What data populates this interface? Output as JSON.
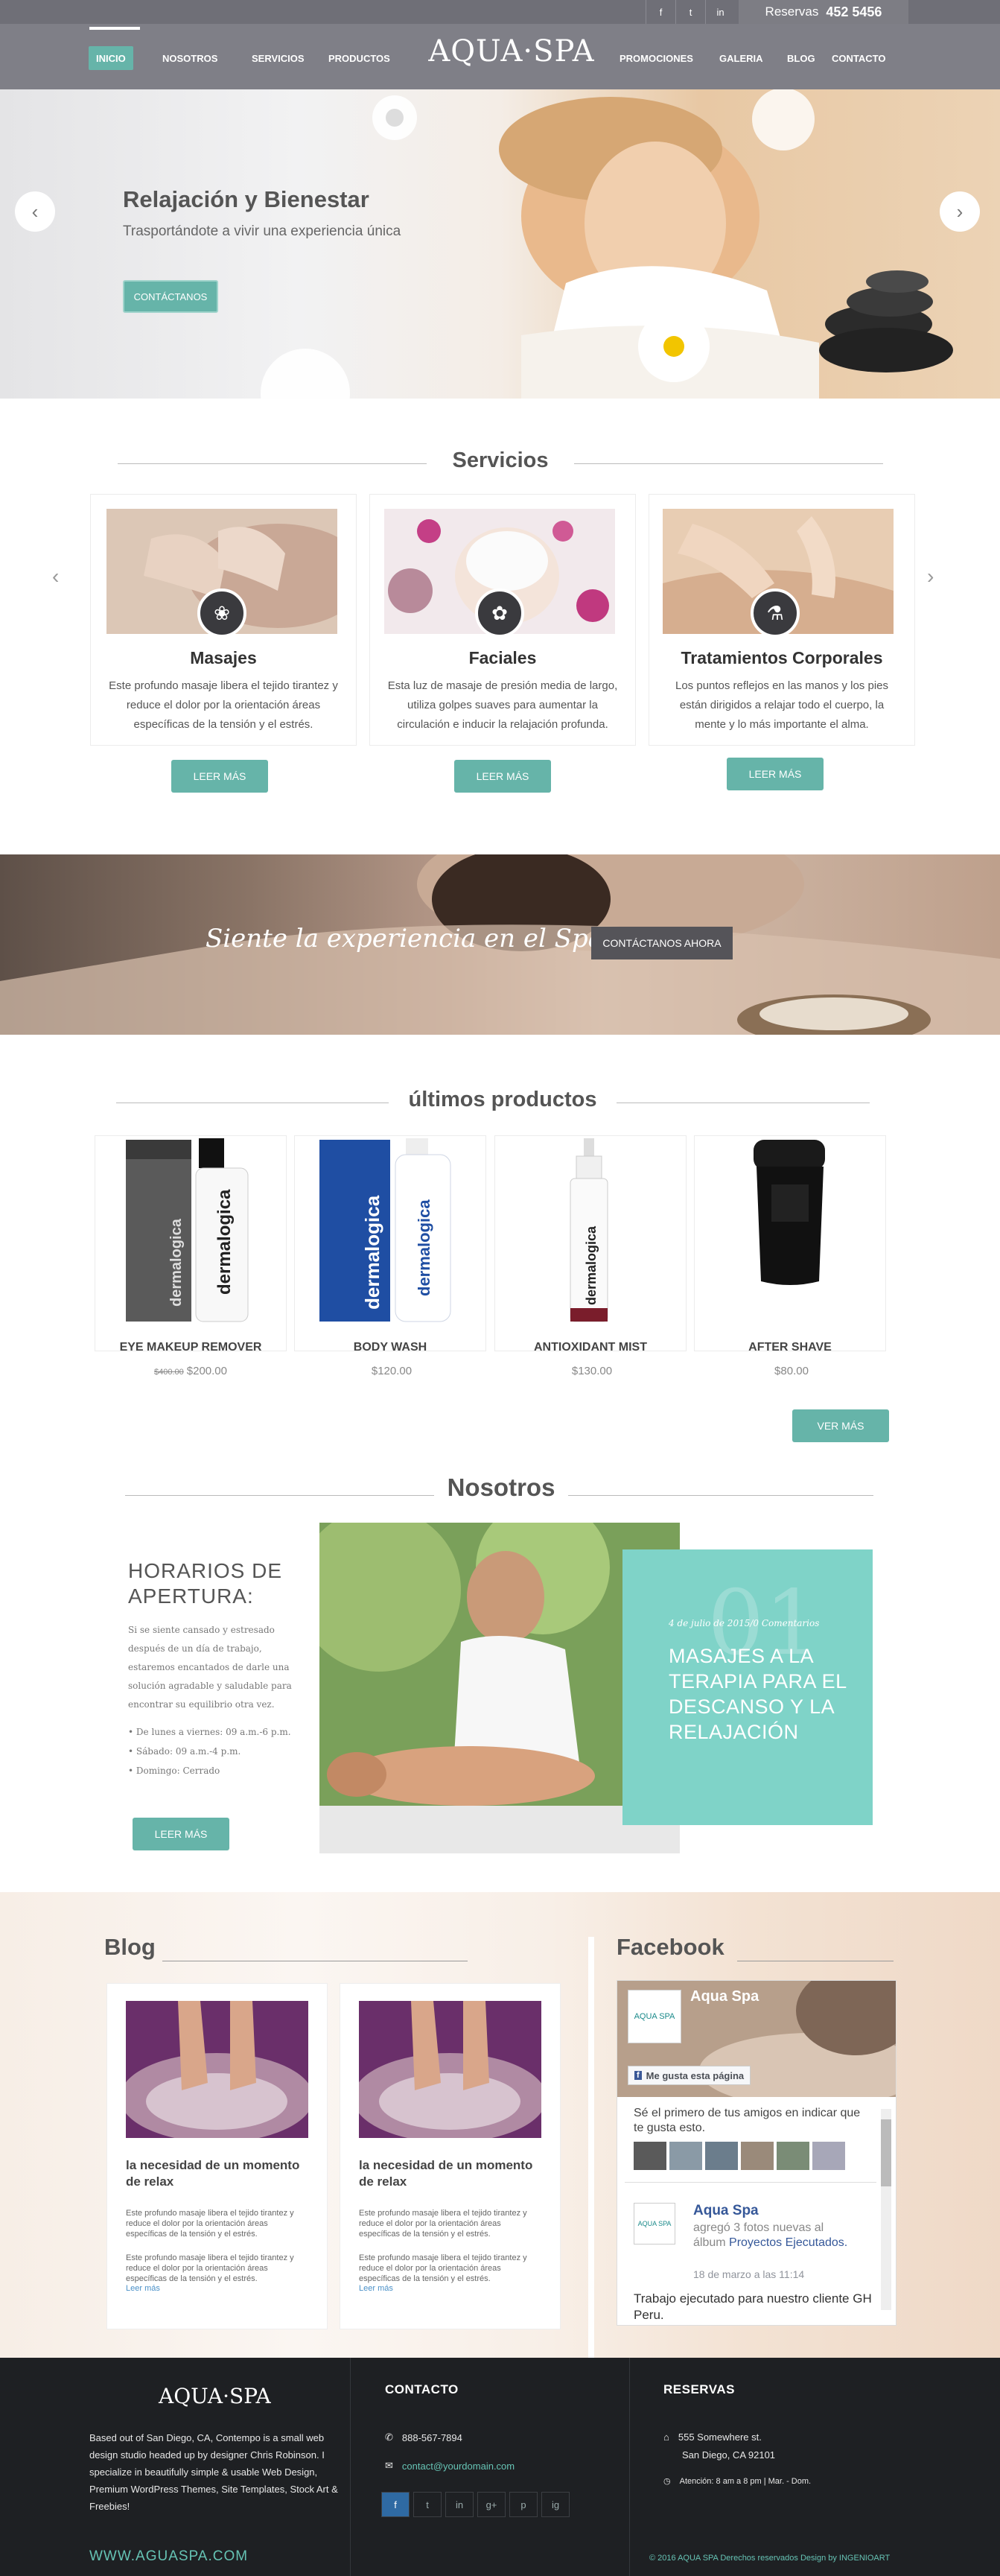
{
  "header": {
    "social": [
      "f",
      "t",
      "in"
    ],
    "reservas_label": "Reservas",
    "reservas_phone": "452 5456",
    "logo": "AQUA·SPA",
    "nav_left": [
      "INICIO",
      "NOSOTROS",
      "SERVICIOS",
      "PRODUCTOS"
    ],
    "nav_right": [
      "PROMOCIONES",
      "GALERIA",
      "BLOG",
      "CONTACTO"
    ]
  },
  "hero": {
    "title": "Relajación y Bienestar",
    "subtitle": "Trasportándote a vivir una experiencia única",
    "button": "CONTÁCTANOS",
    "prev": "‹",
    "next": "›"
  },
  "services": {
    "title": "Servicios",
    "items": [
      {
        "title": "Masajes",
        "text": "Este profundo masaje libera el tejido tirantez y reduce el dolor por la orientación áreas específicas de la tensión y el estrés.",
        "button": "LEER MÁS",
        "icon": "lotus-icon"
      },
      {
        "title": "Faciales",
        "text": "Esta luz de masaje de presión media de largo, utiliza golpes suaves para aumentar la circulación e inducir la relajación profunda.",
        "button": "LEER MÁS",
        "icon": "flower-icon"
      },
      {
        "title": "Tratamientos Corporales",
        "text": "Los puntos reflejos en las manos y los pies están dirigidos a relajar todo el cuerpo, la mente y lo más importante el alma.",
        "button": "LEER MÁS",
        "icon": "oil-bottle-icon"
      }
    ]
  },
  "banner": {
    "text": "Siente la experiencia en el Spa",
    "button": "CONTÁCTANOS AHORA"
  },
  "products": {
    "title": "últimos productos",
    "items": [
      {
        "name": "EYE MAKEUP REMOVER",
        "old_price": "$400.00",
        "price": "$200.00",
        "brand": "dermalogica"
      },
      {
        "name": "BODY WASH",
        "old_price": "",
        "price": "$120.00",
        "brand": "dermalogica"
      },
      {
        "name": "ANTIOXIDANT MIST",
        "old_price": "",
        "price": "$130.00",
        "brand": "dermalogica"
      },
      {
        "name": "AFTER SHAVE",
        "old_price": "",
        "price": "$80.00",
        "brand": ""
      }
    ],
    "button": "VER MÁS"
  },
  "about": {
    "title": "Nosotros",
    "hours_title": "HORARIOS DE APERTURA:",
    "hours_text": "Si se siente cansado y estresado después de un día de trabajo, estaremos encantados de darle una solución agradable y saludable para encontrar su equilibrio otra vez.",
    "hours": [
      "De lunes a viernes: 09 a.m.-6 p.m.",
      "Sábado: 09 a.m.-4 p.m.",
      "Domingo: Cerrado"
    ],
    "button": "LEER MÁS",
    "feature_meta": "4 de julio de 2015/0 Comentarios",
    "feature_num": "01",
    "feature_title": "MASAJES A LA TERAPIA PARA EL DESCANSO Y LA RELAJACIÓN"
  },
  "blog": {
    "title": "Blog",
    "posts": [
      {
        "title": "la necesidad de un momento de relax",
        "p1": "Este profundo masaje libera el tejido tirantez y reduce el dolor por la orientación áreas específicas de la tensión y el estrés.",
        "p2": "Este profundo masaje libera el tejido tirantez y reduce el dolor por la orientación áreas específicas de la tensión y el estrés.",
        "more": "Leer más"
      },
      {
        "title": "la necesidad de un momento de relax",
        "p1": "Este profundo masaje libera el tejido tirantez y reduce el dolor por la orientación áreas específicas de la tensión y el estrés.",
        "p2": "Este profundo masaje libera el tejido tirantez y reduce el dolor por la orientación áreas específicas de la tensión y el estrés.",
        "more": "Leer más"
      }
    ]
  },
  "facebook": {
    "title": "Facebook",
    "page_name": "Aqua Spa",
    "logo_text": "AQUA SPA",
    "like": "Me gusta esta página",
    "friends_text": "Sé el primero de tus amigos en indicar que te gusta esto.",
    "post_author": "Aqua Spa",
    "post_action": "agregó 3 fotos nuevas al álbum",
    "post_album": "Proyectos Ejecutados.",
    "post_date": "18 de marzo a las 11:14",
    "post_body": "Trabajo ejecutado para nuestro cliente GH Peru."
  },
  "footer": {
    "logo": "AQUA·SPA",
    "about": "Based out of San Diego, CA, Contempo is a small web design studio headed up by designer Chris Robinson. I specialize in beautifully simple & usable Web Design, Premium WordPress Themes, Site Templates, Stock Art & Freebies!",
    "url": "WWW.AGUASPA.COM",
    "contact_title": "CONTACTO",
    "phone": "888-567-7894",
    "email": "contact@yourdomain.com",
    "social": [
      "f",
      "t",
      "in",
      "g+",
      "p",
      "ig"
    ],
    "reservas_title": "RESERVAS",
    "address1": "555 Somewhere st.",
    "address2": "San Diego, CA 92101",
    "schedule": "Atención: 8 am a 8 pm  |  Mar. - Dom.",
    "copyright": "© 2016  AQUA SPA  Derechos reservados Design by INGENIOART"
  },
  "colors": {
    "accent": "#66b4a9",
    "teal_box": "#7fd3c8",
    "header": "#7f7f87",
    "footer": "#1e2023",
    "footer_link": "#66c3b4"
  }
}
